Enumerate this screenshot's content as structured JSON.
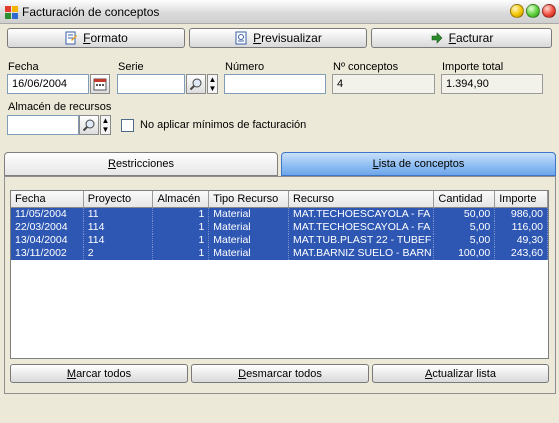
{
  "window": {
    "title": "Facturación de conceptos"
  },
  "toolbar": {
    "formato": {
      "pre": "",
      "key": "F",
      "post": "ormato"
    },
    "previsualizar": {
      "pre": "",
      "key": "P",
      "post": "revisualizar"
    },
    "facturar": {
      "pre": "",
      "key": "F",
      "post": "acturar"
    }
  },
  "form": {
    "fecha_label": "Fecha",
    "fecha_value": "16/06/2004",
    "serie_label": "Serie",
    "serie_value": "",
    "numero_label": "Número",
    "numero_value": "",
    "nconceptos_label": "Nº conceptos",
    "nconceptos_value": "4",
    "importe_label": "Importe total",
    "importe_value": "1.394,90",
    "almacen_label": "Almacén de recursos",
    "almacen_value": "",
    "checkbox_label": "No aplicar mínimos de facturación"
  },
  "tabs": {
    "restricciones": {
      "pre": "",
      "key": "R",
      "post": "estricciones"
    },
    "lista": {
      "pre": "",
      "key": "L",
      "post": "ista de conceptos"
    }
  },
  "table": {
    "headers": [
      "Fecha",
      "Proyecto",
      "Almacén",
      "Tipo Recurso",
      "Recurso",
      "Cantidad",
      "Importe"
    ],
    "rows": [
      [
        "11/05/2004",
        "11",
        "1",
        "Material",
        "MAT.TECHOESCAYOLA - FA",
        "50,00",
        "986,00"
      ],
      [
        "22/03/2004",
        "114",
        "1",
        "Material",
        "MAT.TECHOESCAYOLA - FA",
        "5,00",
        "116,00"
      ],
      [
        "13/04/2004",
        "114",
        "1",
        "Material",
        "MAT.TUB.PLAST 22 - TUBEF",
        "5,00",
        "49,30"
      ],
      [
        "13/11/2002",
        "2",
        "1",
        "Material",
        "MAT.BARNIZ SUELO - BARN",
        "100,00",
        "243,60"
      ]
    ]
  },
  "bottom": {
    "marcar": {
      "pre": "",
      "key": "M",
      "post": "arcar todos"
    },
    "desmarcar": {
      "pre": "",
      "key": "D",
      "post": "esmarcar todos"
    },
    "actualizar": {
      "pre": "",
      "key": "A",
      "post": "ctualizar lista"
    }
  },
  "colors": {
    "selection": "#2e57b3",
    "active_tab": "#8cbcf3"
  }
}
